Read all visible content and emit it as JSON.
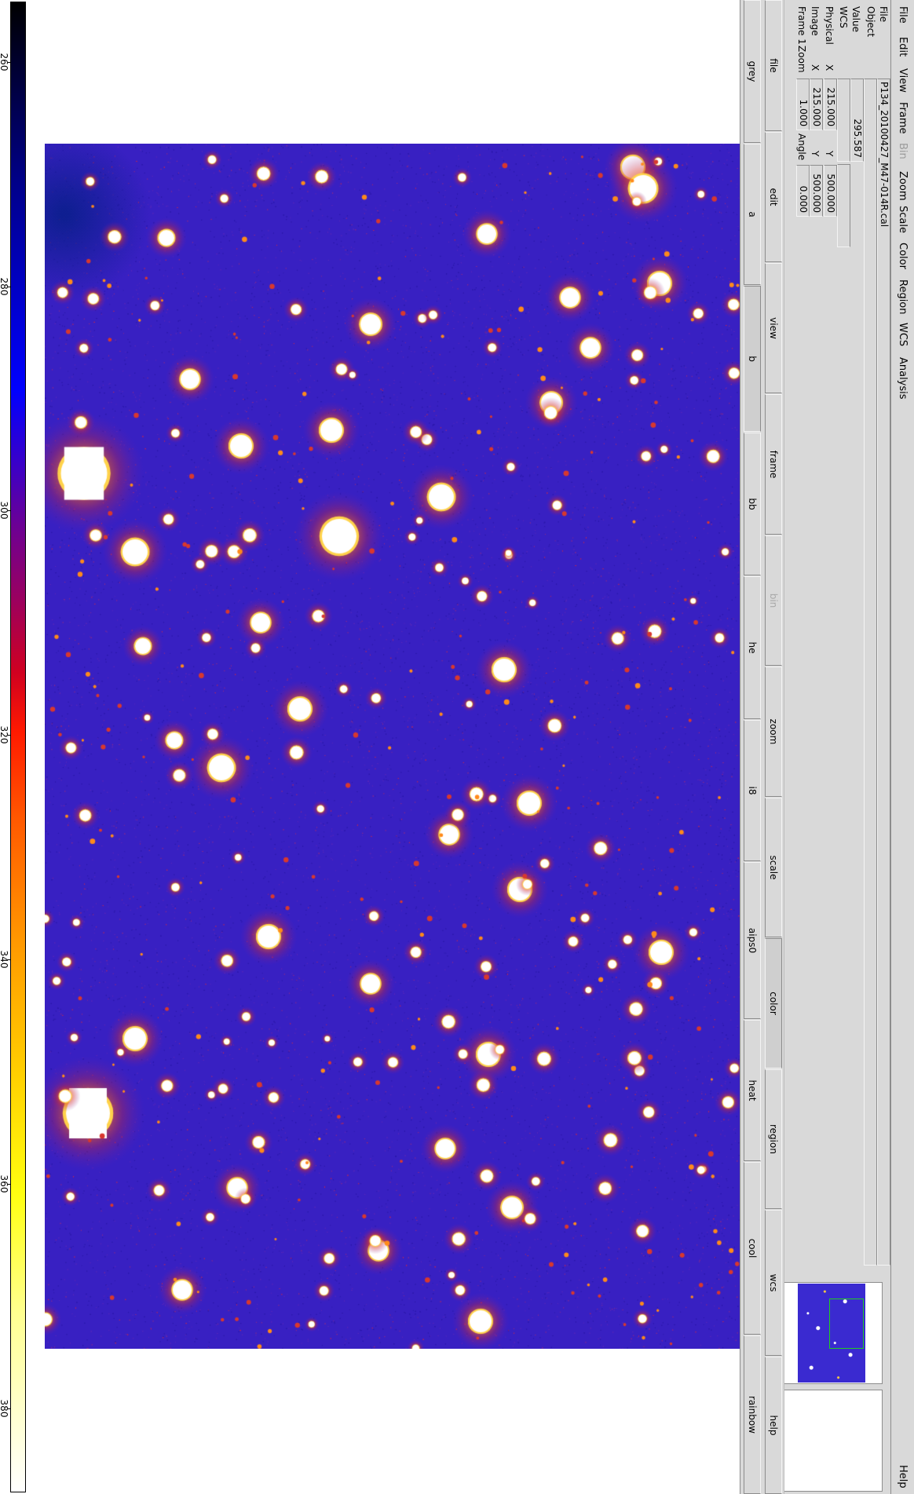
{
  "menubar": {
    "file": "File",
    "edit": "Edit",
    "view": "View",
    "frame": "Frame",
    "bin": "Bin",
    "zoom": "Zoom",
    "scale": "Scale",
    "color": "Color",
    "region": "Region",
    "wcs": "WCS",
    "analysis": "Analysis",
    "help": "Help"
  },
  "info": {
    "file_label": "File",
    "file_value": "P134_20100427_M47-014R.cal",
    "object_label": "Object",
    "object_value": "",
    "value_label": "Value",
    "value_value": "295.587",
    "wcs_label": "WCS",
    "wcs_value": "",
    "physical_label": "Physical",
    "physical_x_label": "X",
    "physical_x": "215.000",
    "physical_y_label": "Y",
    "physical_y": "500.000",
    "image_label": "Image",
    "image_x_label": "X",
    "image_x": "215.000",
    "image_y_label": "Y",
    "image_y": "500.000",
    "frame_label": "Frame 1",
    "zoom_label": "Zoom",
    "zoom_value": "1.000",
    "angle_label": "Angle",
    "angle_value": "0.000"
  },
  "buttons_top": {
    "file": "file",
    "edit": "edit",
    "view": "view",
    "frame": "frame",
    "bin": "bin",
    "zoom": "zoom",
    "scale": "scale",
    "color": "color",
    "region": "region",
    "wcs": "wcs",
    "help": "help"
  },
  "buttons_bottom": {
    "grey": "grey",
    "a": "a",
    "b": "b",
    "bb": "bb",
    "he": "he",
    "i8": "i8",
    "aips0": "aips0",
    "heat": "heat",
    "cool": "cool",
    "rainbow": "rainbow"
  },
  "active": {
    "top_button": "color",
    "colormap": "b"
  },
  "colorbar": {
    "labels": [
      "260",
      "280",
      "300",
      "320",
      "340",
      "360",
      "380"
    ]
  },
  "colors": {
    "ui_gray": "#d9d9d9",
    "sky_background": "#3820c2",
    "star_core": "#ffffff",
    "star_halo": "#ffd000",
    "panner_box": "#22cc22"
  },
  "icons": {
    "panner": "panner-thumbnail",
    "magnifier": "magnifier-view"
  }
}
